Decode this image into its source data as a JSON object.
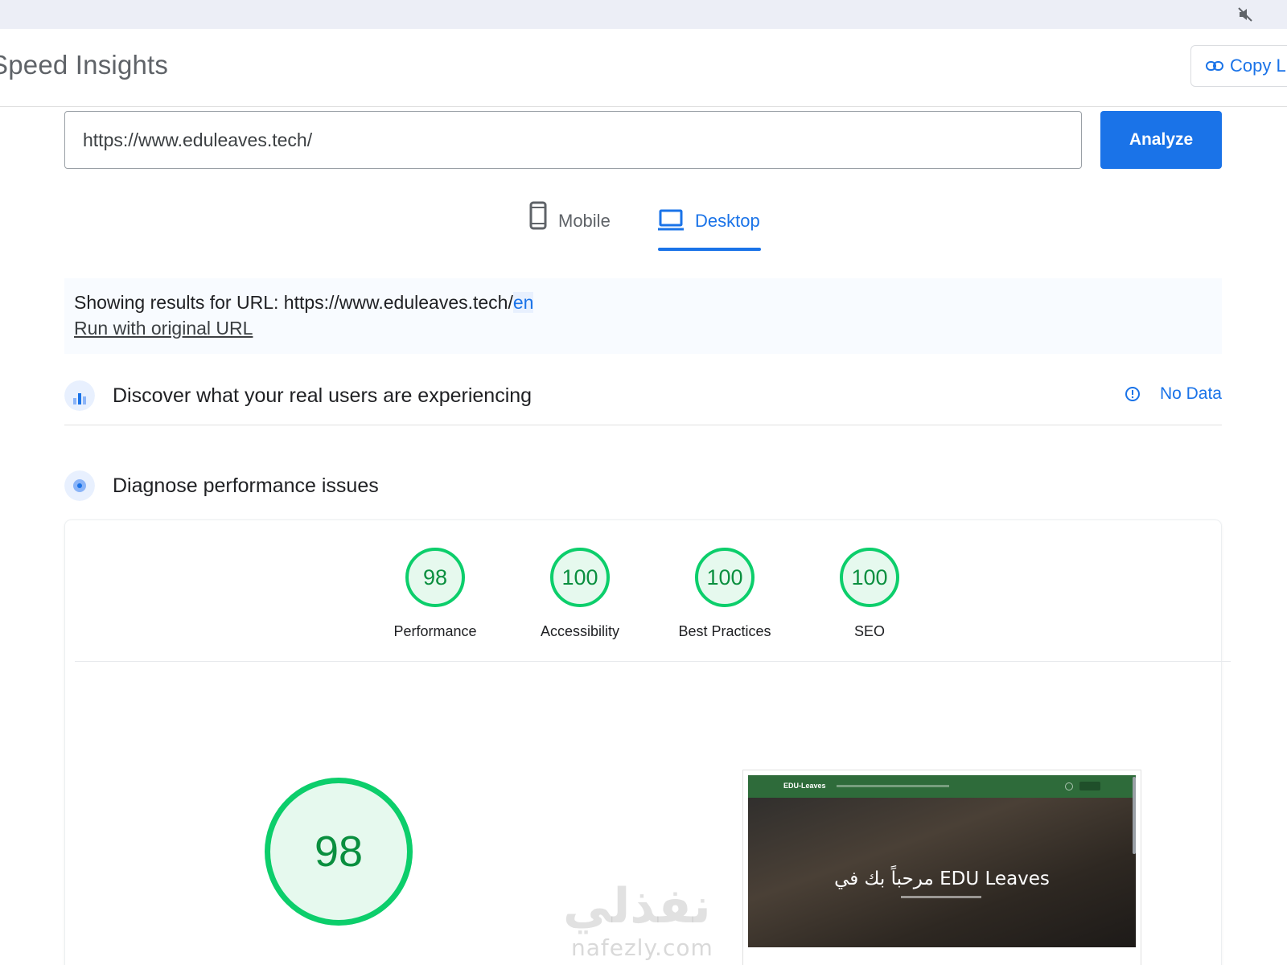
{
  "header": {
    "title": "Speed Insights",
    "copy_link_label": "Copy L"
  },
  "search": {
    "url_value": "https://www.eduleaves.tech/",
    "analyze_label": "Analyze"
  },
  "tabs": [
    {
      "label": "Mobile",
      "icon": "phone-icon",
      "selected": false
    },
    {
      "label": "Desktop",
      "icon": "laptop-icon",
      "selected": true
    }
  ],
  "notice": {
    "prefix": "Showing results for URL: https://www.eduleaves.tech/",
    "highlight": "en",
    "rerun_link": "Run with original URL"
  },
  "crux": {
    "title": "Discover what your real users are experiencing",
    "status": "No Data",
    "icon": "chart-icon"
  },
  "diagnose": {
    "title": "Diagnose performance issues",
    "icon": "target-icon"
  },
  "scores": [
    {
      "value": "98",
      "label": "Performance"
    },
    {
      "value": "100",
      "label": "Accessibility"
    },
    {
      "value": "100",
      "label": "Best Practices"
    },
    {
      "value": "100",
      "label": "SEO"
    }
  ],
  "performance_detail": {
    "score": "98"
  },
  "page_screenshot": {
    "logo": "EDU-Leaves",
    "heading": "مرحباً بك في EDU Leaves"
  },
  "watermark": {
    "arabic": "نفذلي",
    "latin": "nafezly.com"
  },
  "colors": {
    "accent": "#1a73e8",
    "score_good": "#0cce6b",
    "score_good_fill": "#e6f9ee"
  }
}
